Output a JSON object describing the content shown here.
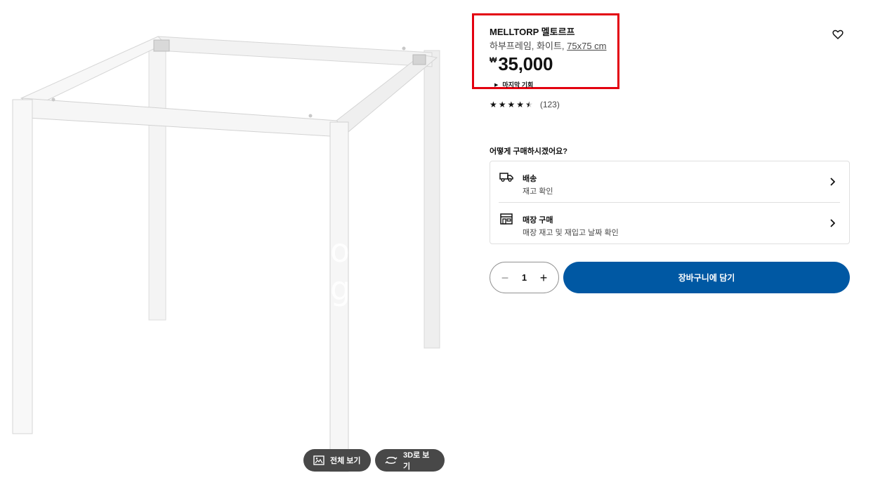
{
  "product": {
    "name": "MELLTORP 멜토르프",
    "description": "하부프레임, 화이트, ",
    "size": "75x75 cm",
    "currency_symbol": "₩",
    "price": "35,000",
    "last_chance": "마지막 기회",
    "rating_value": 4.5,
    "rating_count": "(123)",
    "watermark": "o g"
  },
  "image_buttons": {
    "full_view_label": "전체 보기",
    "view_3d_label": "3D로 보기"
  },
  "purchase": {
    "heading": "어떻게 구매하시겠어요?",
    "options": [
      {
        "title": "배송",
        "subtitle": "재고 확인",
        "icon": "truck-icon"
      },
      {
        "title": "매장 구매",
        "subtitle": "매장 재고 및 재입고 날짜 확인",
        "icon": "store-icon"
      }
    ]
  },
  "quantity": {
    "value": "1",
    "minus_symbol": "−",
    "plus_symbol": "+"
  },
  "cart": {
    "add_label": "장바구니에 담기"
  },
  "colors": {
    "cart_button": "#0058a3",
    "highlight_box": "#e3000f",
    "image_button_bg": "#484848"
  }
}
